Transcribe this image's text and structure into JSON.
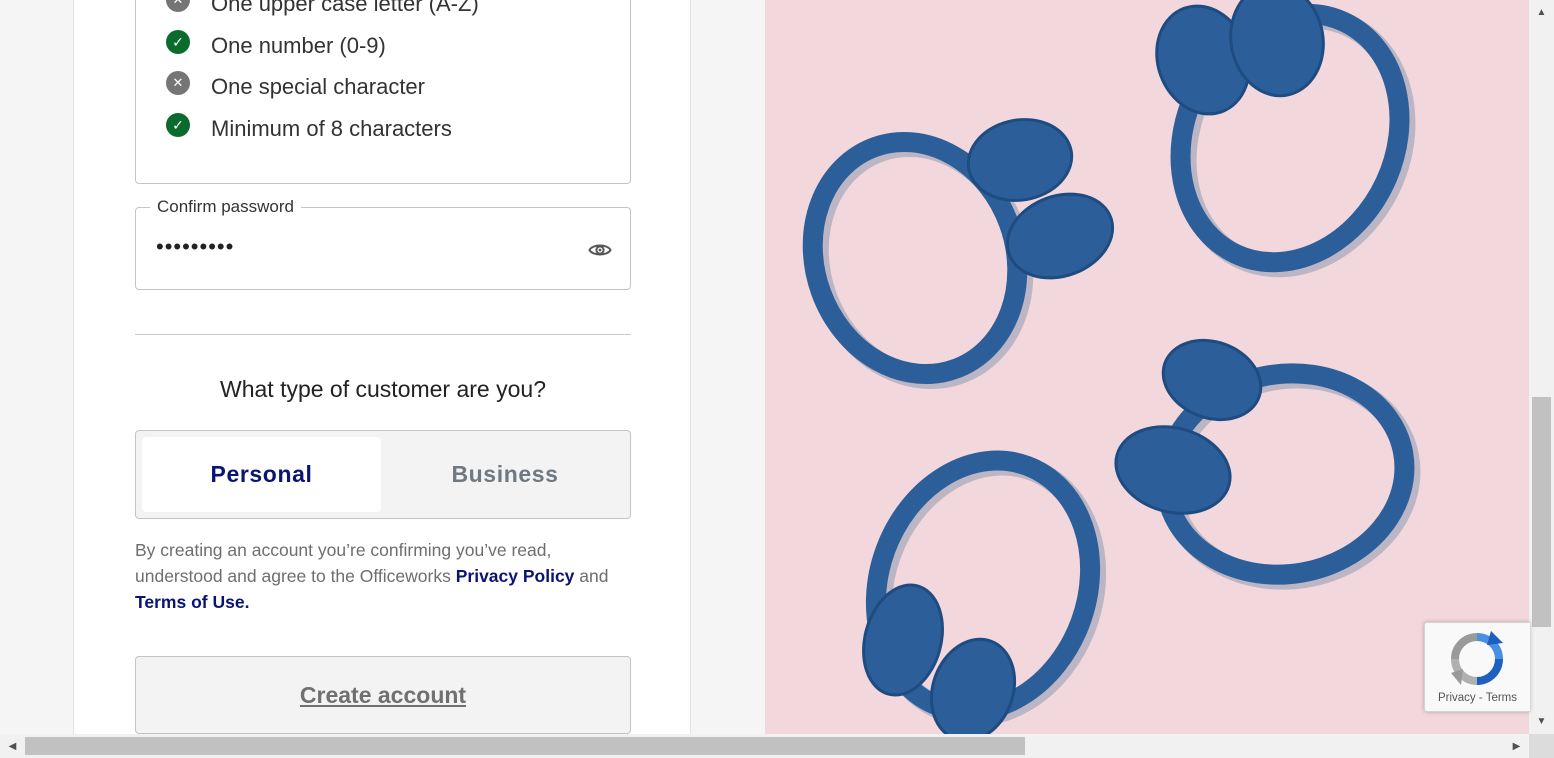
{
  "password_requirements": [
    {
      "label": "One upper case letter (A-Z)",
      "met": false,
      "icon": "cross-icon"
    },
    {
      "label": "One number (0-9)",
      "met": true,
      "icon": "check-icon"
    },
    {
      "label": "One special character",
      "met": false,
      "icon": "cross-icon"
    },
    {
      "label": "Minimum of 8 characters",
      "met": true,
      "icon": "check-icon"
    }
  ],
  "confirm_password": {
    "label": "Confirm password",
    "value": "•••••••••"
  },
  "customer_type": {
    "question": "What type of customer are you?",
    "options": [
      "Personal",
      "Business"
    ],
    "selected": "Personal"
  },
  "terms": {
    "text_before": "By creating an account you’re confirming you’ve read, understood and agree to the Officeworks ",
    "privacy_link": "Privacy Policy",
    "text_middle": " and ",
    "terms_link": "Terms of Use."
  },
  "create_account": "Create account",
  "recaptcha": {
    "privacy": "Privacy",
    "separator": " - ",
    "terms": "Terms"
  },
  "colors": {
    "navy": "#0a1473",
    "success": "#0b6b2d",
    "unmet": "#757575",
    "hero_bg": "#f2d8dc",
    "headphone_blue": "#2c5f9a"
  }
}
